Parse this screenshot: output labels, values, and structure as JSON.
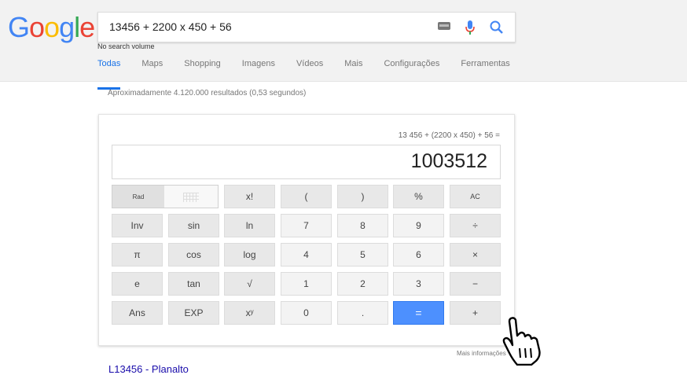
{
  "logo": {
    "text": "Google"
  },
  "search": {
    "query": "13456 + 2200 x 450 + 56",
    "no_search_volume": "No search volume"
  },
  "tabs": [
    {
      "label": "Todas",
      "active": true
    },
    {
      "label": "Maps"
    },
    {
      "label": "Shopping"
    },
    {
      "label": "Imagens"
    },
    {
      "label": "Vídeos"
    },
    {
      "label": "Mais"
    },
    {
      "label": "Configurações"
    },
    {
      "label": "Ferramentas"
    }
  ],
  "results": {
    "count_text": "Aproximadamente 4.120.000 resultados (0,53 segundos)"
  },
  "calculator": {
    "expression": "13 456 + (2200 x 450) + 56 =",
    "display": "1003512",
    "rad_label": "Rad",
    "buttons": {
      "fact": "x!",
      "lparen": "(",
      "rparen": ")",
      "percent": "%",
      "ac": "AC",
      "inv": "Inv",
      "sin": "sin",
      "ln": "ln",
      "n7": "7",
      "n8": "8",
      "n9": "9",
      "div": "÷",
      "pi": "π",
      "cos": "cos",
      "log": "log",
      "n4": "4",
      "n5": "5",
      "n6": "6",
      "mul": "×",
      "e": "e",
      "tan": "tan",
      "sqrt": "√",
      "n1": "1",
      "n2": "2",
      "n3": "3",
      "sub": "−",
      "ans": "Ans",
      "exp": "EXP",
      "pow": "xʸ",
      "n0": "0",
      "dot": ".",
      "eq": "=",
      "add": "+"
    }
  },
  "more_info": "Mais informações",
  "first_result_link": "L13456 - Planalto",
  "colors": {
    "accent": "#1a73e8",
    "equals": "#4d90fe",
    "link": "#1a0dab"
  }
}
